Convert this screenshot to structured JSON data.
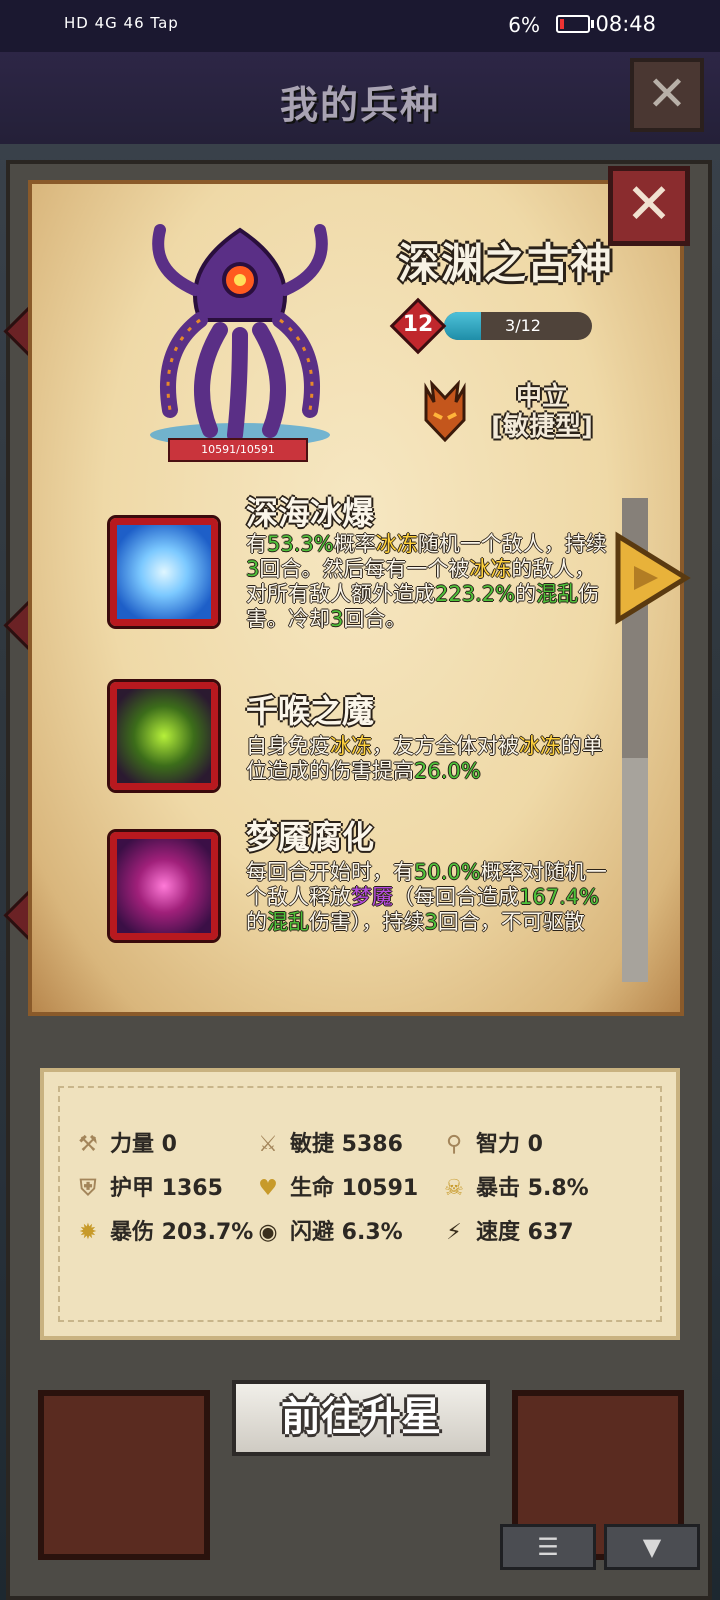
{
  "status_bar": {
    "left_indicators": "HD 4G 46 Tap",
    "battery": "6%",
    "time": "08:48"
  },
  "header": {
    "title": "我的兵种"
  },
  "unit": {
    "name": "深渊之古神",
    "level": "12",
    "xp_text": "3/12",
    "xp_fraction": 0.25,
    "hp_text": "10591/10591",
    "alignment": "中立",
    "type": "[敏捷型]"
  },
  "skills": [
    {
      "title": "深海冰爆",
      "desc": [
        {
          "t": "有",
          "c": ""
        },
        {
          "t": "53.3%",
          "c": "green"
        },
        {
          "t": "概率",
          "c": ""
        },
        {
          "t": "冰冻",
          "c": "yellow"
        },
        {
          "t": "随机一个敌人，持续",
          "c": ""
        },
        {
          "t": "3",
          "c": "green"
        },
        {
          "t": "回合。然后每有一个被",
          "c": ""
        },
        {
          "t": "冰冻",
          "c": "yellow"
        },
        {
          "t": "的敌人，对所有敌人额外造成",
          "c": ""
        },
        {
          "t": "223.2%",
          "c": "green"
        },
        {
          "t": "的",
          "c": ""
        },
        {
          "t": "混乱",
          "c": "green"
        },
        {
          "t": "伤害。冷却",
          "c": ""
        },
        {
          "t": "3",
          "c": "green"
        },
        {
          "t": "回合。",
          "c": ""
        }
      ]
    },
    {
      "title": "千喉之魔",
      "desc": [
        {
          "t": "自身免疫",
          "c": ""
        },
        {
          "t": "冰冻",
          "c": "yellow"
        },
        {
          "t": "，友方全体对被",
          "c": ""
        },
        {
          "t": "冰冻",
          "c": "yellow"
        },
        {
          "t": "的单位造成的伤害提高",
          "c": ""
        },
        {
          "t": "26.0%",
          "c": "green"
        }
      ]
    },
    {
      "title": "梦魇腐化",
      "desc": [
        {
          "t": "每回合开始时，有",
          "c": ""
        },
        {
          "t": "50.0%",
          "c": "green"
        },
        {
          "t": "概率对随机一个敌人释放",
          "c": ""
        },
        {
          "t": "梦魇",
          "c": "purple"
        },
        {
          "t": "（每回合造成",
          "c": ""
        },
        {
          "t": "167.4%",
          "c": "green"
        },
        {
          "t": "的",
          "c": ""
        },
        {
          "t": "混乱",
          "c": "green"
        },
        {
          "t": "伤害），持续",
          "c": ""
        },
        {
          "t": "3",
          "c": "green"
        },
        {
          "t": "回合，不可驱散",
          "c": ""
        }
      ]
    }
  ],
  "stats": [
    {
      "icon": "axe-icon",
      "label": "力量",
      "value": "0"
    },
    {
      "icon": "sword-icon",
      "label": "敏捷",
      "value": "5386"
    },
    {
      "icon": "staff-icon",
      "label": "智力",
      "value": "0"
    },
    {
      "icon": "shield-icon",
      "label": "护甲",
      "value": "1365"
    },
    {
      "icon": "heart-icon",
      "label": "生命",
      "value": "10591"
    },
    {
      "icon": "skull-icon",
      "label": "暴击",
      "value": "5.8%"
    },
    {
      "icon": "burst-icon",
      "label": "暴伤",
      "value": "203.7%"
    },
    {
      "icon": "eye-icon",
      "label": "闪避",
      "value": "6.3%"
    },
    {
      "icon": "lightning-icon",
      "label": "速度",
      "value": "637"
    }
  ],
  "buttons": {
    "upgrade_star": "前往升星"
  },
  "colors": {
    "highlight_yellow": "#ffd23c",
    "highlight_green": "#4fc13a",
    "highlight_purple": "#b64ce0",
    "skill_border": "#b8191f"
  }
}
